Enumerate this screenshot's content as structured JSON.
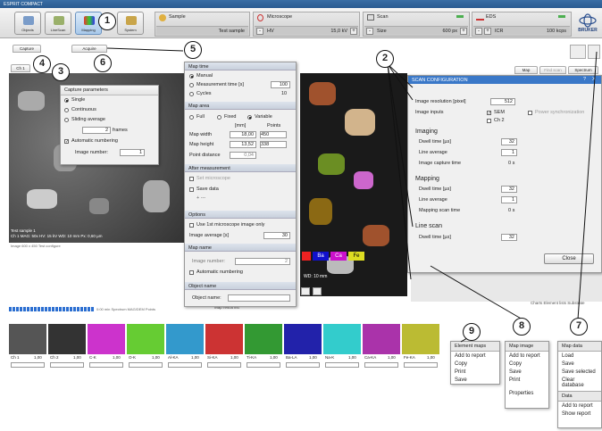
{
  "window": {
    "title": "ESPRIT COMPACT"
  },
  "toolbar": {
    "buttons": [
      {
        "label": "Objects"
      },
      {
        "label": "LineScan"
      },
      {
        "label": "Mapping"
      },
      {
        "label": "System"
      }
    ]
  },
  "sample": {
    "header": "Sample",
    "value": "Test sample"
  },
  "microscope": {
    "header": "Microscope",
    "param": "HV",
    "value": "15,0 kV"
  },
  "scan": {
    "header": "Scan",
    "param": "Size",
    "value": "600 px"
  },
  "eds": {
    "header": "EDS",
    "param": "ICR",
    "value": "100 kcps"
  },
  "brand": "BRUKER",
  "tabs": {
    "capture": "Capture",
    "acquire": "Acquire",
    "ch1": "Ch 1",
    "map": "Map",
    "find_scan": "Find scan",
    "spectrum": "Spectrum"
  },
  "capture": {
    "title": "Capture parameters",
    "single": "Single",
    "continuous": "Continuous",
    "sliding": "Sliding average",
    "frames_value": "2",
    "frames_label": "frames",
    "auto_numbering": "Automatic numbering",
    "image_number_label": "Image number:",
    "image_number": "1"
  },
  "sem_info": {
    "line1": "Test sample 1",
    "line2": "Ch 1  MAG: 50x  HV: 15 kV  WD: 10 mm  Px: 0,60 µm",
    "line3": "Image  600 x 450  Test configure",
    "wd": "WD: 10 mm"
  },
  "map_params": {
    "map_time": "Map time",
    "manual": "Manual",
    "measurement_time": "Measurement time [s]",
    "measurement_time_value": "100",
    "cycles": "Cycles",
    "cycles_value": "10",
    "map_area": "Map area",
    "full": "Full",
    "fixed": "Fixed",
    "variable": "Variable",
    "mm": "[mm]",
    "points": "Points",
    "map_width": "Map width",
    "map_width_mm": "18,00",
    "map_width_pts": "450",
    "map_height": "Map height",
    "map_height_mm": "13,52",
    "map_height_pts": "338",
    "point_distance": "Point distance",
    "point_distance_value": "0,04",
    "after": "After measurement",
    "set_microscope": "Set microscope",
    "save_data": "Save data",
    "save_sub": "+ ---",
    "options": "Options",
    "use_first": "Use 1st microscope image only",
    "image_average": "Image average [s]",
    "image_average_value": "30",
    "map_name": "Map name",
    "image_number": "Image number:",
    "image_number_value": "2",
    "auto_numbering": "Automatic numbering",
    "object_name": "Object name",
    "object_name_label": "Object name:"
  },
  "scan_config": {
    "title": "SCAN CONFIGURATION",
    "help": "?",
    "close_x": "X",
    "resolution_label": "Image resolution [pixel]",
    "resolution_value": "512",
    "inputs_label": "Image inputs",
    "sem": "SEM",
    "ch2": "Ch 2",
    "power_sync": "Power synchronization",
    "imaging": "Imaging",
    "dwell_label": "Dwell time [µs]",
    "dwell_imaging": "32",
    "line_average": "Line average",
    "line_average_imaging": "1",
    "capture_time": "Image capture time",
    "capture_time_value": "0 s",
    "mapping": "Mapping",
    "dwell_mapping": "32",
    "line_average_mapping": "1",
    "mapping_scan_time": "Mapping scan time",
    "mapping_scan_value": "0 s",
    "line_scan": "Line scan",
    "dwell_linescan": "32",
    "close_button": "Close"
  },
  "elements_badges": [
    "Ba",
    "Ca",
    "Fe"
  ],
  "map_labels": {
    "map_result": "Map result list",
    "status_right": "Charts  Element lists  Substrate",
    "progress": "0:00 min  Spectrum  MAG/DEM Points",
    "elements_right": "Element"
  },
  "element_row": [
    {
      "name": "Ch 1",
      "value": "1,00"
    },
    {
      "name": "Ch 2",
      "value": "1,00"
    },
    {
      "name": "C-K",
      "value": "1,00"
    },
    {
      "name": "O-K",
      "value": "1,00"
    },
    {
      "name": "Al-KA",
      "value": "1,00"
    },
    {
      "name": "Si-KA",
      "value": "1,00"
    },
    {
      "name": "Ti-KA",
      "value": "1,00"
    },
    {
      "name": "Ba-LA",
      "value": "1,00"
    },
    {
      "name": "Na-K",
      "value": "1,00"
    },
    {
      "name": "Ca-KA",
      "value": "1,00"
    },
    {
      "name": "Fe-KA",
      "value": "1,00"
    }
  ],
  "element_menu": {
    "title": "Element maps",
    "items": [
      "Add to report",
      "Copy",
      "Print",
      "Save"
    ]
  },
  "map_image_menu": {
    "title": "Map image",
    "items": [
      "Add to report",
      "Copy",
      "Save",
      "Print",
      "Properties"
    ]
  },
  "map_data_menu": {
    "title": "Map data",
    "items": [
      "Load",
      "Save",
      "Save selected",
      "Clear database"
    ],
    "data_title": "Data",
    "data_items": [
      "Add to report",
      "Show report"
    ]
  },
  "callouts": [
    "1",
    "2",
    "3",
    "4",
    "5",
    "6",
    "7",
    "8",
    "9"
  ],
  "colors": {
    "accent": "#3a6ea5",
    "highlight": "#2c6fd1"
  }
}
